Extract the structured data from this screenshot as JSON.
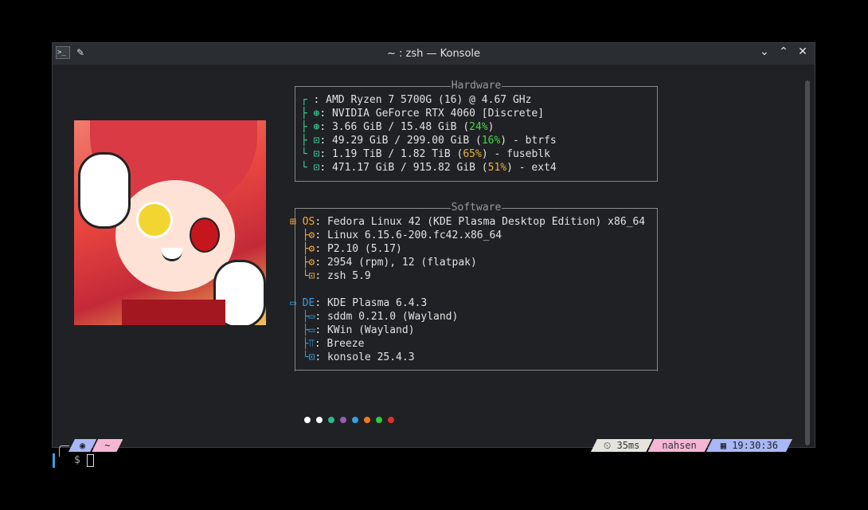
{
  "window": {
    "title": "~ : zsh — Konsole"
  },
  "icons": {
    "app": "terminal-icon",
    "pin": "pin-icon",
    "min": "chevron-down-icon",
    "max": "chevron-up-icon",
    "close": "close-icon"
  },
  "hardware": {
    "title": "Hardware",
    "lines": [
      {
        "tree": "┌",
        "icon": "",
        "label": "AMD Ryzen 7 5700G (16) @ 4.67 GHz"
      },
      {
        "tree": "├",
        "icon": "⊛",
        "label": "NVIDIA GeForce RTX 4060 [Discrete]"
      },
      {
        "tree": "├",
        "icon": "⊛",
        "pre": "3.66 GiB / 15.48 GiB (",
        "pct": "24%",
        "post": ")"
      },
      {
        "tree": "├",
        "icon": "⊡",
        "pre": "49.29 GiB / 299.00 GiB (",
        "pct": "16%",
        "post": ") - btrfs"
      },
      {
        "tree": "└",
        "icon": "⊡",
        "pre": "1.19 TiB / 1.82 TiB (",
        "pct": "65%",
        "post": ") - fuseblk"
      },
      {
        "tree": "└",
        "icon": "⊡",
        "pre": "471.17 GiB / 915.82 GiB (",
        "pct": "51%",
        "post": ") - ext4"
      }
    ]
  },
  "software": {
    "title": "Software",
    "os_key": "OS",
    "os_value": "Fedora Linux 42 (KDE Plasma Desktop Edition) x86_64",
    "os_lines": [
      "Linux 6.15.6-200.fc42.x86_64",
      "P2.10 (5.17)",
      "2954 (rpm), 12 (flatpak)",
      "zsh 5.9"
    ],
    "de_key": "DE",
    "de_value": "KDE Plasma 6.4.3",
    "de_lines": [
      "sddm 0.21.0 (Wayland)",
      "KWin (Wayland)",
      "Breeze",
      "konsole 25.4.3"
    ]
  },
  "palette": [
    "#ffffff",
    "#ffffff",
    "#2fb88a",
    "#9b59b6",
    "#3a9fe0",
    "#f27a1a",
    "#2ecc40",
    "#e0302c"
  ],
  "prompt": {
    "os_icon": "fedora-icon",
    "dir": "~",
    "duration": "35ms",
    "user": "nahsen",
    "time": "19:30:36",
    "symbol": "$"
  }
}
